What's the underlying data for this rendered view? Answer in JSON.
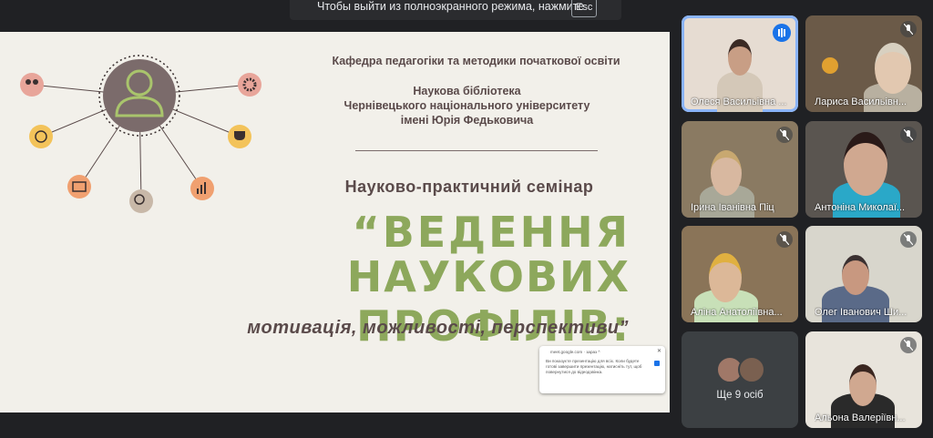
{
  "banner": {
    "message": "Чтобы выйти из полноэкранного режима, нажмите",
    "key": "Esc"
  },
  "slide": {
    "department": "Кафедра педагогіки та методики початкової освіти",
    "library_lines": [
      "Наукова  бібліотека",
      "Чернівецького національного університету",
      "імені Юрія Федьковича"
    ],
    "seminar": "Науково-практичний семінар",
    "title_line1": "“ВЕДЕННЯ",
    "title_line2": "НАУКОВИХ ПРОФІЛІВ:",
    "subtitle": "мотивація, можливості, перспективи”"
  },
  "popup": {
    "domain": "meet.google.com · зараз ^",
    "text": "Ви показуєте презентацію для всіх. Коли будете готові завершити презентацію, натисніть тут, щоб повернутися до відеодзвінка."
  },
  "participants": [
    {
      "name": "Олеся Васильівна ...",
      "speaking": true
    },
    {
      "name": "Лариса Васильівн...",
      "muted": true
    },
    {
      "name": "Ірина Іванівна Піц",
      "muted": true
    },
    {
      "name": "Антоніна Миколаї...",
      "muted": true
    },
    {
      "name": "Аліна Анатоліївна...",
      "muted": true
    },
    {
      "name": "Олег Іванович Ши...",
      "muted": true
    },
    {
      "name": "Альона Валеріївн...",
      "muted": true
    }
  ],
  "more_participants": "Ще 9 осіб",
  "colors": {
    "accent": "#8da85c",
    "slide_text": "#5a4a4a",
    "active_tile_border": "#8ab4f8",
    "speaking": "#1a73e8"
  }
}
